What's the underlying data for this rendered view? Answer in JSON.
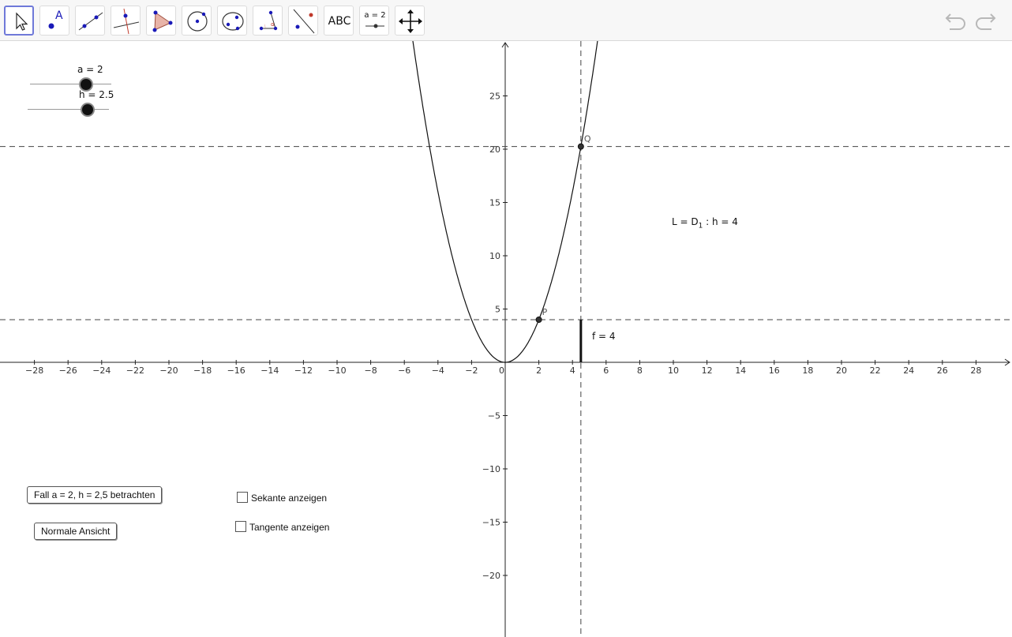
{
  "toolbar": {
    "tools": [
      {
        "name": "move-tool",
        "label": ""
      },
      {
        "name": "point-tool",
        "label": "A"
      },
      {
        "name": "line-tool",
        "label": ""
      },
      {
        "name": "perpendicular-tool",
        "label": ""
      },
      {
        "name": "polygon-tool",
        "label": ""
      },
      {
        "name": "circle-tool",
        "label": ""
      },
      {
        "name": "conic-tool",
        "label": ""
      },
      {
        "name": "angle-tool",
        "label": ""
      },
      {
        "name": "reflect-tool",
        "label": ""
      },
      {
        "name": "text-tool",
        "label": "ABC"
      },
      {
        "name": "slider-tool",
        "label": "a = 2"
      },
      {
        "name": "move-graphics-tool",
        "label": ""
      }
    ]
  },
  "sliders": {
    "a": {
      "label": "a = 2",
      "value": 2,
      "min": 0,
      "max": 2.5
    },
    "h": {
      "label": "h = 2.5",
      "value": 2.5,
      "min": 0,
      "max": 3.2
    }
  },
  "buttons": {
    "fall": "Fall a = 2, h = 2,5 betrachten",
    "normal": "Normale Ansicht"
  },
  "checkboxes": {
    "sekante": "Sekante anzeigen",
    "tangente": "Tangente anzeigen"
  },
  "texts": {
    "limit_prefix": "L = D",
    "limit_sub": "1",
    "limit_suffix": " : h =  4",
    "f_value": "f = 4"
  },
  "points": {
    "P": {
      "label": "P",
      "x": 2,
      "y": 4
    },
    "Q": {
      "label": "Q",
      "x": 4.5,
      "y": 20.25
    }
  },
  "chart_data": {
    "type": "line",
    "function": "f(x) = x^2",
    "xlim": [
      -30,
      30
    ],
    "ylim": [
      -25,
      30
    ],
    "x_ticks": [
      -28,
      -26,
      -24,
      -22,
      -20,
      -18,
      -16,
      -14,
      -12,
      -10,
      -8,
      -6,
      -4,
      -2,
      0,
      2,
      4,
      6,
      8,
      10,
      12,
      14,
      16,
      18,
      20,
      22,
      24,
      26,
      28
    ],
    "y_ticks": [
      -20,
      -15,
      -10,
      -5,
      5,
      10,
      15,
      20,
      25
    ],
    "horizontal_dashed_lines": [
      4,
      20.25
    ],
    "vertical_dashed_line": 4.5,
    "segment": {
      "x": 4.5,
      "y_from": 0,
      "y_to": 4
    }
  },
  "colors": {
    "active_tool_border": "#6f79d9",
    "point_color": "#333333",
    "tool_blue": "#1a1ab8",
    "tool_red": "#c0392b"
  }
}
